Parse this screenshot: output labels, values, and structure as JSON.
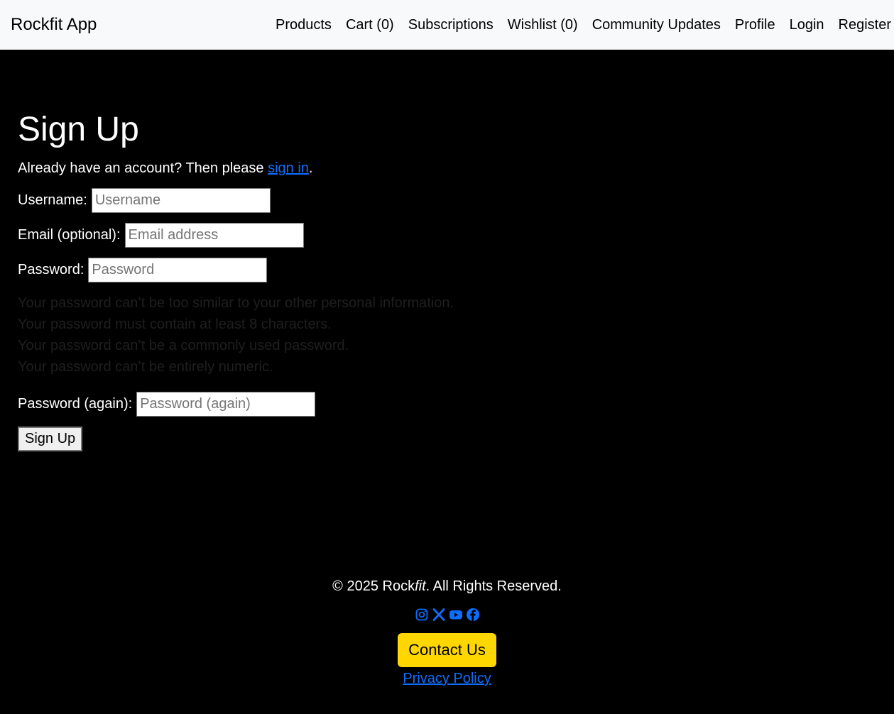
{
  "navbar": {
    "brand": "Rockfit App",
    "links": [
      "Products",
      "Cart (0)",
      "Subscriptions",
      "Wishlist (0)",
      "Community Updates",
      "Profile",
      "Login",
      "Register"
    ]
  },
  "signup": {
    "title": "Sign Up",
    "intro_before": "Already have an account? Then please ",
    "intro_link": "sign in",
    "intro_after": ".",
    "username_label": "Username:",
    "username_placeholder": "Username",
    "email_label": "Email (optional):",
    "email_placeholder": "Email address",
    "password_label": "Password:",
    "password_placeholder": "Password",
    "password_help": [
      "Your password can’t be too similar to your other personal information.",
      "Your password must contain at least 8 characters.",
      "Your password can’t be a commonly used password.",
      "Your password can’t be entirely numeric."
    ],
    "password_again_label": "Password (again):",
    "password_again_placeholder": "Password (again)",
    "submit_label": "Sign Up"
  },
  "footer": {
    "copyright_before": "© 2025 Rock",
    "copyright_italic": "fit",
    "copyright_after": ". All Rights Reserved.",
    "social_icons": [
      "instagram-icon",
      "x-icon",
      "youtube-icon",
      "facebook-icon"
    ],
    "contact_label": "Contact Us",
    "privacy_label": "Privacy Policy"
  },
  "colors": {
    "background": "#000000",
    "navbar_bg": "#f8f9fa",
    "link": "#0d6efd",
    "contact_bg": "#ffd700",
    "help_text": "#1f1f1f"
  }
}
